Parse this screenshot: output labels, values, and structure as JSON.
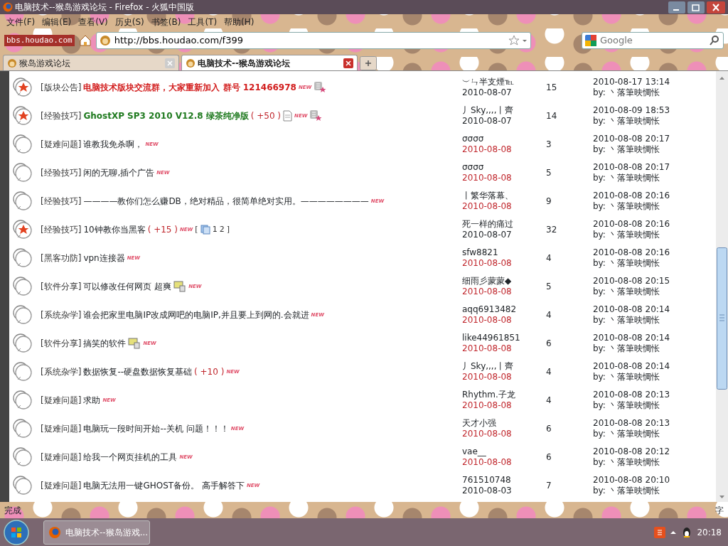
{
  "window": {
    "title": "电脑技术--猴岛游戏论坛 - Firefox - 火狐中国版"
  },
  "menu": [
    "文件(F)",
    "编辑(E)",
    "查看(V)",
    "历史(S)",
    "书签(B)",
    "工具(T)",
    "帮助(H)"
  ],
  "logo": {
    "text": "bbs.houdao.com"
  },
  "address": {
    "value": "http://bbs.houdao.com/f399"
  },
  "search": {
    "placeholder": "Google"
  },
  "tabs": [
    {
      "label": "猴岛游戏论坛",
      "selected": false
    },
    {
      "label": "电脑技术--猴岛游戏论坛",
      "selected": true
    }
  ],
  "threads": [
    {
      "hot": true,
      "category": "[版块公告]",
      "title": "电脑技术版块交流群，大家重新加入 群号 121466978",
      "kind": "announcement",
      "tags": [
        {
          "kind": "new",
          "text": "NEW"
        },
        {
          "kind": "digest"
        }
      ],
      "author": "︶ㄣ半支煙℡",
      "date": "2010-08-07",
      "date_new": false,
      "replies": "15",
      "last_time": "2010-08-17 13:14",
      "last_by": "by: 丶落筆映惆怅"
    },
    {
      "hot": true,
      "category": "[经验技巧]",
      "title": "GhostXP SP3 2010 V12.8 绿茶纯净版",
      "kind": "featured",
      "tags": [
        {
          "kind": "rating",
          "text": "( +50 )"
        },
        {
          "kind": "document"
        },
        {
          "kind": "new",
          "text": "NEW"
        },
        {
          "kind": "digest"
        }
      ],
      "author": "丿Sky,,,,丨齊",
      "date": "2010-08-07",
      "date_new": false,
      "replies": "14",
      "last_time": "2010-08-09 18:53",
      "last_by": "by: 丶落筆映惆怅"
    },
    {
      "hot": false,
      "category": "[疑难问题]",
      "title": "谁教我免杀啊，",
      "kind": "normal",
      "tags": [
        {
          "kind": "new",
          "text": "NEW"
        }
      ],
      "author": "σσσσ",
      "date": "2010-08-08",
      "date_new": true,
      "replies": "3",
      "last_time": "2010-08-08 20:17",
      "last_by": "by: 丶落筆映惆怅"
    },
    {
      "hot": false,
      "category": "[经验技巧]",
      "title": "闲的无聊,插个广告",
      "kind": "normal",
      "tags": [
        {
          "kind": "new",
          "text": "NEW"
        }
      ],
      "author": "σσσσ",
      "date": "2010-08-08",
      "date_new": true,
      "replies": "5",
      "last_time": "2010-08-08 20:17",
      "last_by": "by: 丶落筆映惆怅"
    },
    {
      "hot": false,
      "category": "[经验技巧]",
      "title": "————教你们怎么赚DB，绝对精品，很简单绝对实用。————————",
      "kind": "normal",
      "tags": [
        {
          "kind": "new",
          "text": "NEW"
        }
      ],
      "author": "丨繁华落幕、",
      "date": "2010-08-08",
      "date_new": true,
      "replies": "9",
      "last_time": "2010-08-08 20:16",
      "last_by": "by: 丶落筆映惆怅"
    },
    {
      "hot": true,
      "category": "[经验技巧]",
      "title": "10钟教你当黑客",
      "kind": "normal",
      "tags": [
        {
          "kind": "rating",
          "text": "( +15 )"
        },
        {
          "kind": "new",
          "text": "NEW"
        },
        {
          "kind": "pages",
          "open": "[",
          "pages": [
            "1",
            "2"
          ],
          "close": "]"
        }
      ],
      "author": "死一样的痛过",
      "date": "2010-08-07",
      "date_new": false,
      "replies": "32",
      "last_time": "2010-08-08 20:16",
      "last_by": "by: 丶落筆映惆怅"
    },
    {
      "hot": false,
      "category": "[黑客功防]",
      "title": "vpn连接器",
      "kind": "normal",
      "tags": [
        {
          "kind": "new",
          "text": "NEW"
        }
      ],
      "author": "sfw8821",
      "date": "2010-08-08",
      "date_new": true,
      "replies": "4",
      "last_time": "2010-08-08 20:16",
      "last_by": "by: 丶落筆映惆怅"
    },
    {
      "hot": false,
      "category": "[软件分享]",
      "title": "可以修改任何网页  超爽",
      "kind": "normal",
      "tags": [
        {
          "kind": "software"
        },
        {
          "kind": "new",
          "text": "NEW"
        }
      ],
      "author": "细雨彡蒙蒙◆",
      "date": "2010-08-08",
      "date_new": true,
      "replies": "5",
      "last_time": "2010-08-08 20:15",
      "last_by": "by: 丶落筆映惆怅"
    },
    {
      "hot": false,
      "category": "[系统杂学]",
      "title": "谁会把家里电脑IP改成网吧的电脑IP,并且要上到网的.会就进",
      "kind": "normal",
      "tags": [
        {
          "kind": "new",
          "text": "NEW"
        }
      ],
      "author": "aqq6913482",
      "date": "2010-08-08",
      "date_new": true,
      "replies": "4",
      "last_time": "2010-08-08 20:14",
      "last_by": "by: 丶落筆映惆怅"
    },
    {
      "hot": false,
      "category": "[软件分享]",
      "title": "搞笑的软件",
      "kind": "normal",
      "tags": [
        {
          "kind": "software"
        },
        {
          "kind": "new",
          "text": "NEW"
        }
      ],
      "author": "like44961851",
      "date": "2010-08-08",
      "date_new": true,
      "replies": "6",
      "last_time": "2010-08-08 20:14",
      "last_by": "by: 丶落筆映惆怅"
    },
    {
      "hot": false,
      "category": "[系统杂学]",
      "title": "数据恢复--硬盘数据恢复基础",
      "kind": "normal",
      "tags": [
        {
          "kind": "rating",
          "text": "( +10 )"
        },
        {
          "kind": "new",
          "text": "NEW"
        }
      ],
      "author": "丿Sky,,,,丨齊",
      "date": "2010-08-08",
      "date_new": true,
      "replies": "4",
      "last_time": "2010-08-08 20:14",
      "last_by": "by: 丶落筆映惆怅"
    },
    {
      "hot": false,
      "category": "[疑难问题]",
      "title": "求助",
      "kind": "normal",
      "tags": [
        {
          "kind": "new",
          "text": "NEW"
        }
      ],
      "author": "Rhythm.子龙",
      "date": "2010-08-08",
      "date_new": true,
      "replies": "4",
      "last_time": "2010-08-08 20:13",
      "last_by": "by: 丶落筆映惆怅"
    },
    {
      "hot": false,
      "category": "[疑难问题]",
      "title": "电脑玩一段时间开始--关机 问题！！！",
      "kind": "normal",
      "tags": [
        {
          "kind": "new",
          "text": "NEW"
        }
      ],
      "author": "天才小强",
      "date": "2010-08-08",
      "date_new": true,
      "replies": "6",
      "last_time": "2010-08-08 20:13",
      "last_by": "by: 丶落筆映惆怅"
    },
    {
      "hot": false,
      "category": "[疑难问题]",
      "title": "给我一个网页挂机的工具",
      "kind": "normal",
      "tags": [
        {
          "kind": "new",
          "text": "NEW"
        }
      ],
      "author": "vae__",
      "date": "2010-08-08",
      "date_new": true,
      "replies": "6",
      "last_time": "2010-08-08 20:12",
      "last_by": "by: 丶落筆映惆怅"
    },
    {
      "hot": false,
      "category": "[疑难问题]",
      "title": "电脑无法用一键GHOST备份。 高手解答下",
      "kind": "normal",
      "tags": [
        {
          "kind": "new",
          "text": "NEW"
        }
      ],
      "author": "761510748",
      "date": "2010-08-03",
      "date_new": false,
      "replies": "7",
      "last_time": "2010-08-08 20:10",
      "last_by": "by: 丶落筆映惆怅"
    }
  ],
  "status_bar": {
    "text": "完成",
    "ime": "字"
  },
  "taskbar": {
    "task": "电脑技术--猴岛游戏...",
    "clock": "20:18"
  }
}
